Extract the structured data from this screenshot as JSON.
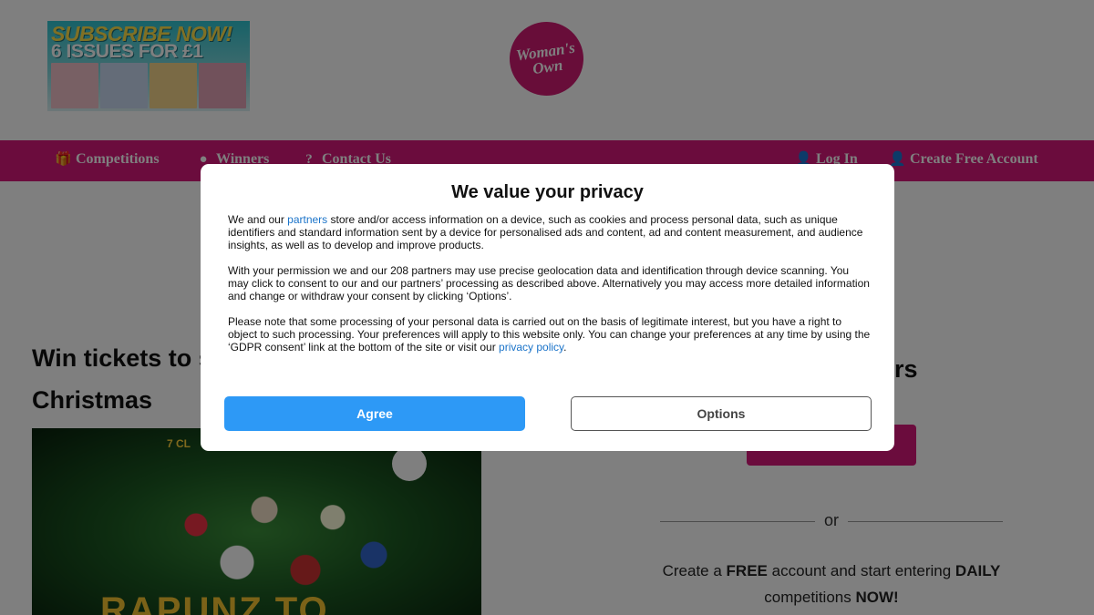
{
  "header": {
    "promo": {
      "line1": "SUBSCRIBE NOW!",
      "line2": "6 ISSUES FOR £1"
    },
    "logo": {
      "line1": "Woman's",
      "line2": "Own"
    }
  },
  "nav": {
    "left": [
      {
        "icon": "gift-icon",
        "label": "Competitions"
      },
      {
        "icon": "map-marker-icon",
        "label": "Winners"
      },
      {
        "icon": "question-icon",
        "label": "Contact Us"
      }
    ],
    "right": [
      {
        "icon": "user-icon",
        "label": "Log In"
      },
      {
        "icon": "user-plus-icon",
        "label": "Create Free Account"
      }
    ]
  },
  "article": {
    "title_visible_line1": "Win tickets to s",
    "title_visible_line2": "Christmas",
    "image": {
      "brand": "7 CL",
      "title_fragment": "RAPUNZ TO"
    }
  },
  "sidebar": {
    "title_fragment": "ers",
    "or_text": "or",
    "free_text": {
      "part1": "Create a ",
      "bold1": "FREE",
      "part2": " account and start entering ",
      "bold2": "DAILY",
      "part3": " competitions ",
      "bold3": "NOW!"
    }
  },
  "consent": {
    "title": "We value your privacy",
    "p1_before": "We and our ",
    "p1_link": "partners",
    "p1_after": " store and/or access information on a device, such as cookies and process personal data, such as unique identifiers and standard information sent by a device for personalised ads and content, ad and content measurement, and audience insights, as well as to develop and improve products.",
    "p2": "With your permission we and our 208 partners may use precise geolocation data and identification through device scanning. You may click to consent to our and our partners’ processing as described above. Alternatively you may access more detailed information and change or withdraw your consent by clicking ‘Options’.",
    "p3_before": "Please note that some processing of your personal data is carried out on the basis of legitimate interest, but you have a right to object to such processing. Your preferences will apply to this website only. You can change your preferences at any time by using the ‘GDPR consent’ link at the bottom of the site or visit our ",
    "p3_link": "privacy policy",
    "p3_after": ".",
    "agree_label": "Agree",
    "options_label": "Options"
  },
  "colors": {
    "brand_pink": "#d6187a",
    "agree_blue": "#2d99f6",
    "link_blue": "#1a73c9"
  }
}
